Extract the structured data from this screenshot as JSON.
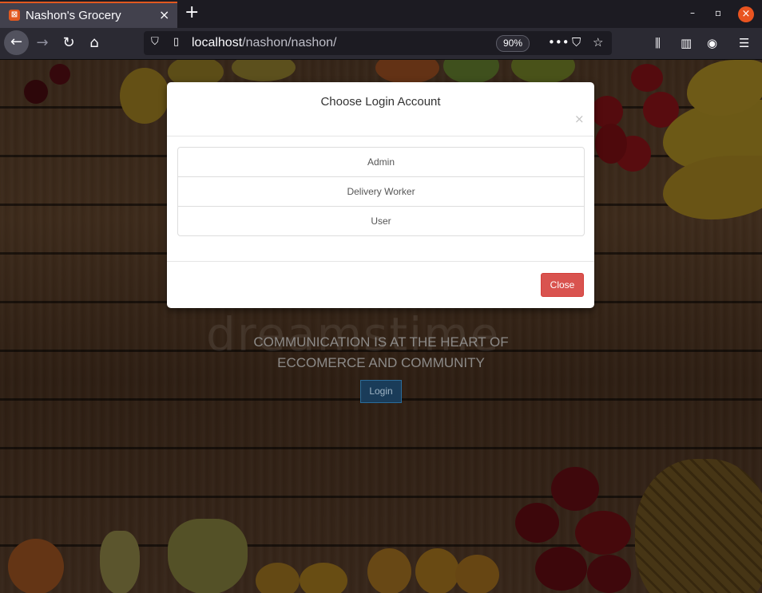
{
  "browser": {
    "tab_title": "Nashon's Grocery",
    "tab_close": "×",
    "new_tab": "+",
    "url_host": "localhost",
    "url_path": "/nashon/nashon/",
    "zoom": "90%",
    "window_controls": {
      "minimize": "–",
      "maximize": "▫",
      "close": "×"
    },
    "accent_color": "#e25920"
  },
  "page": {
    "tagline_line1": "COMMUNICATION IS AT THE HEART OF",
    "tagline_line2": "ECCOMERCE AND COMMUNITY",
    "login_label": "Login",
    "watermark": "dreamstime"
  },
  "modal": {
    "title": "Choose Login Account",
    "close_x": "×",
    "options": [
      "Admin",
      "Delivery Worker",
      "User"
    ],
    "close_label": "Close",
    "close_color": "#d9534f"
  }
}
